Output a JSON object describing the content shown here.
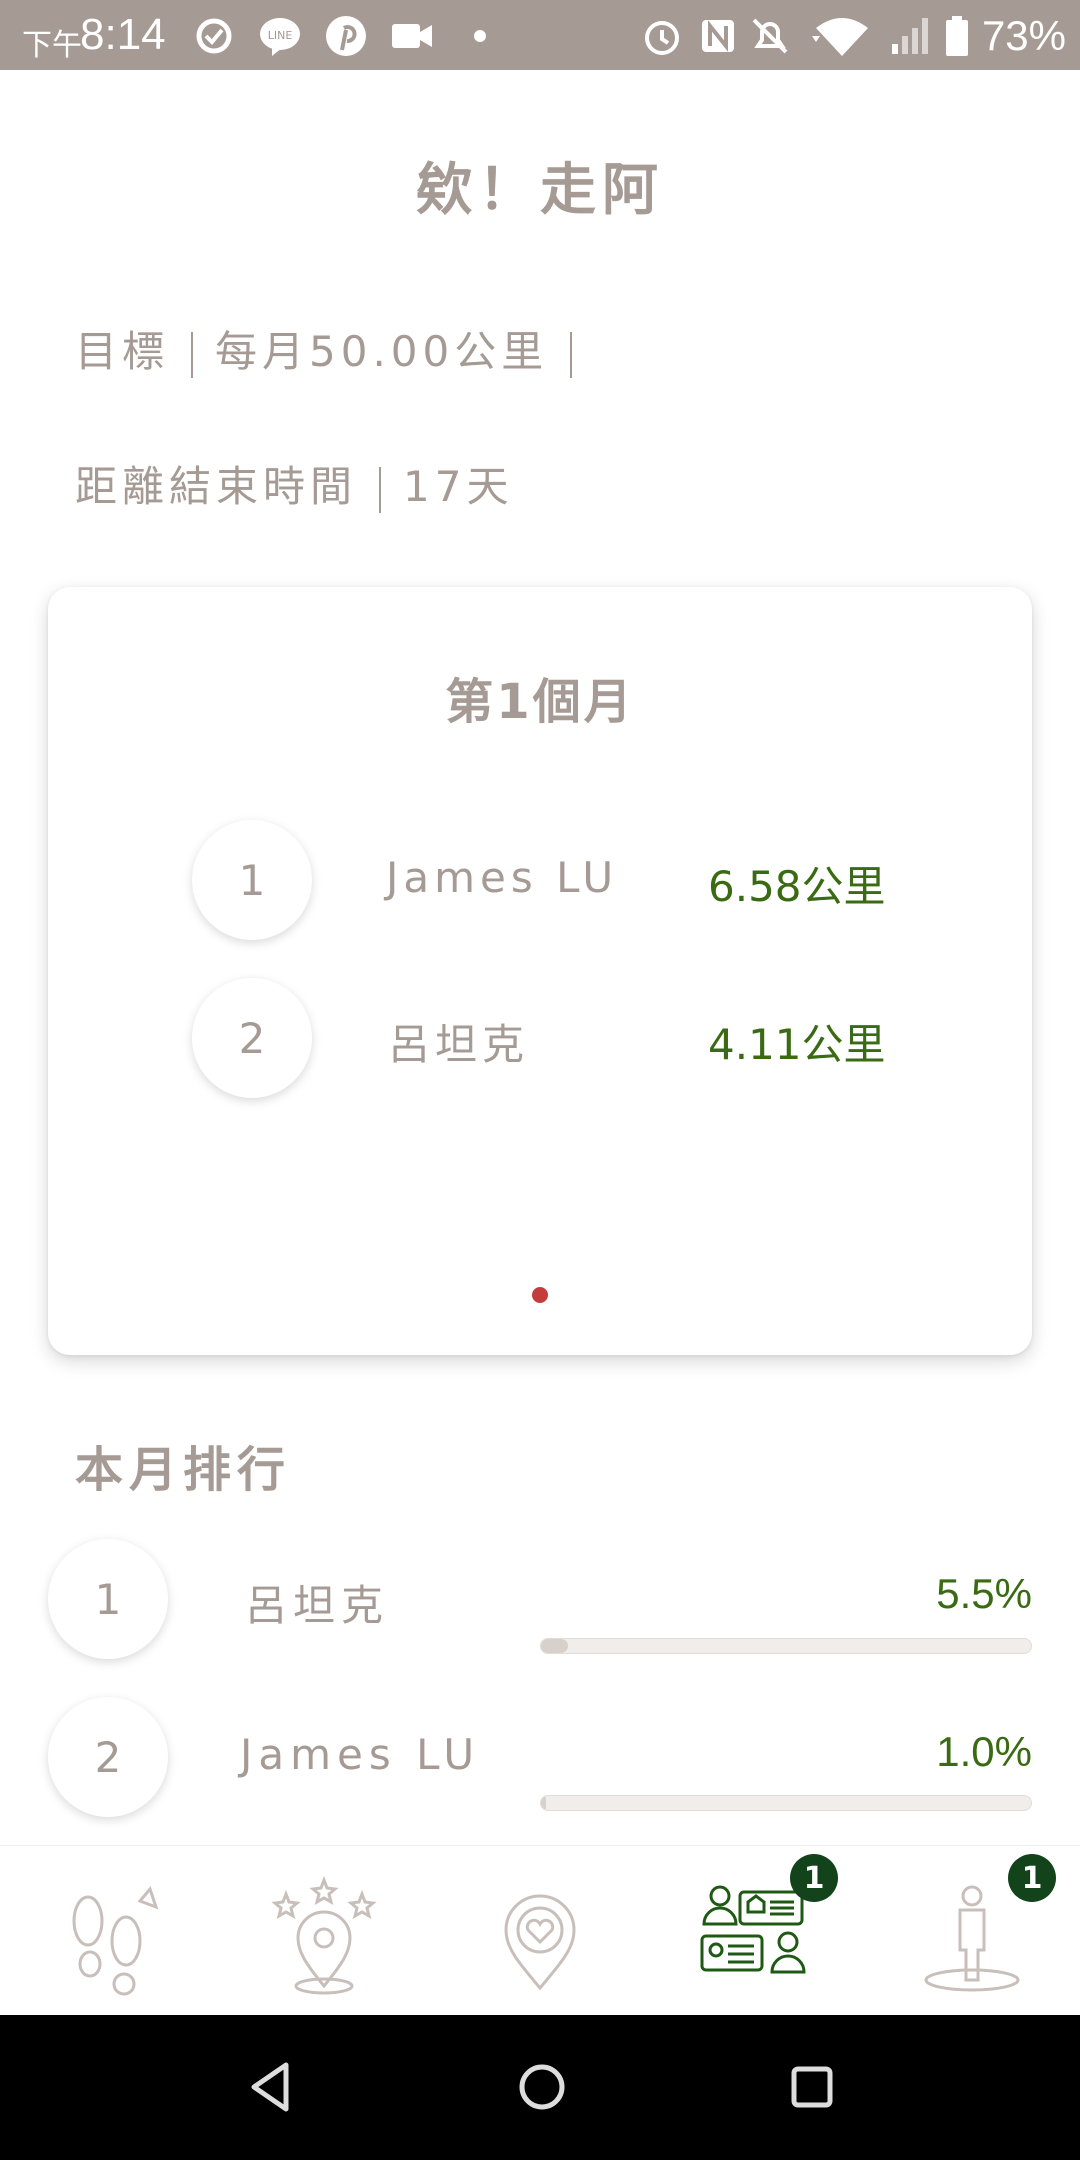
{
  "status_bar": {
    "time_prefix": "下午",
    "time": "8:14",
    "battery": "73%",
    "icons": [
      "sync-icon",
      "line-icon",
      "pinterest-icon",
      "video-icon",
      "dot-icon",
      "alarm-icon",
      "nfc-icon",
      "mute-icon",
      "wifi-icon",
      "signal-icon",
      "battery-icon"
    ]
  },
  "header": {
    "title": "欸！走阿",
    "goal_label": "目標",
    "goal_value": "每月50.00公里",
    "remaining_label": "距離結束時間",
    "remaining_value": "17天"
  },
  "card": {
    "title": "第1個月",
    "rows": [
      {
        "rank": "1",
        "name": "James LU",
        "distance": "6.58公里"
      },
      {
        "rank": "2",
        "name": "呂坦克",
        "distance": "4.11公里"
      }
    ]
  },
  "monthly_ranking": {
    "title": "本月排行",
    "rows": [
      {
        "rank": "1",
        "name": "呂坦克",
        "percent": "5.5%",
        "progress": 0.055
      },
      {
        "rank": "2",
        "name": "James LU",
        "percent": "1.0%",
        "progress": 0.01
      }
    ]
  },
  "bottom_nav": {
    "items": [
      {
        "icon": "footsteps-icon",
        "badge": ""
      },
      {
        "icon": "star-location-icon",
        "badge": ""
      },
      {
        "icon": "heart-location-icon",
        "badge": ""
      },
      {
        "icon": "group-chat-icon",
        "badge": "1"
      },
      {
        "icon": "person-icon",
        "badge": "1"
      }
    ],
    "active_index": 3
  },
  "colors": {
    "status_bar": "#a59a94",
    "text_muted": "#a59a94",
    "accent_green": "#3a6b12",
    "badge_bg": "#12431a",
    "page_dot": "#c43c3c"
  }
}
